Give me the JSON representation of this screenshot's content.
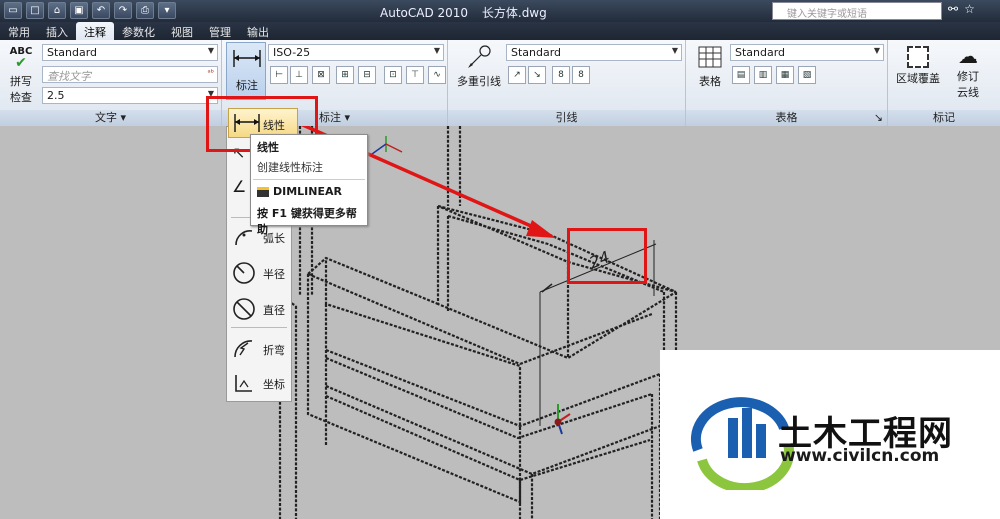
{
  "titlebar": {
    "app": "AutoCAD 2010",
    "file": "长方体.dwg",
    "search_placeholder": "键入关键字或短语"
  },
  "tabs": [
    "常用",
    "插入",
    "注释",
    "参数化",
    "视图",
    "管理",
    "输出"
  ],
  "active_tab": "注释",
  "text_panel": {
    "spell_label_1": "拼写",
    "spell_label_2": "检查",
    "style_value": "Standard",
    "find_placeholder": "查找文字",
    "height_value": "2.5",
    "title": "文字"
  },
  "dim_panel": {
    "big_button_label": "标注",
    "style_value": "ISO-25",
    "title": "标注"
  },
  "leader_panel": {
    "big_button_label": "多重引线",
    "style_value": "Standard",
    "title": "引线"
  },
  "table_panel": {
    "big_button_label": "表格",
    "style_value": "Standard",
    "title": "表格"
  },
  "markup_panel": {
    "btn1": "区域覆盖",
    "btn2_line1": "修订",
    "btn2_line2": "云线",
    "title": "标记"
  },
  "flyout": {
    "linear": "线性",
    "items": [
      "弧长",
      "半径",
      "直径",
      "折弯",
      "坐标"
    ]
  },
  "tooltip": {
    "title": "线性",
    "desc": "创建线性标注",
    "command": "DIMLINEAR",
    "help": "按 F1 键获得更多帮助"
  },
  "drawing": {
    "dimension_text": "24"
  },
  "watermark": {
    "brand": "土木工程网",
    "url": "www.civilcn.com"
  },
  "colors": {
    "accent_red": "#e01616",
    "canvas_bg": "#bdbdbd",
    "active_highlight": "#f6d985"
  }
}
